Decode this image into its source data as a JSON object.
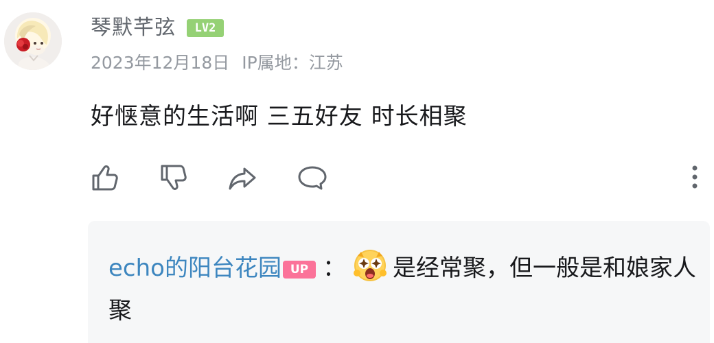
{
  "comment": {
    "username": "琴默芊弦",
    "level": "LV2",
    "date": "2023年12月18日",
    "ip_label": "IP属地：江苏",
    "text": "好惬意的生活啊  三五好友 时长相聚"
  },
  "actions": {
    "like_icon": "thumb-up-icon",
    "dislike_icon": "thumb-down-icon",
    "share_icon": "share-icon",
    "reply_icon": "comment-icon",
    "more_icon": "more-vertical-icon"
  },
  "reply_preview": {
    "author": "echo的阳台花园",
    "badge": "UP",
    "colon": "：",
    "emoji_icon": "surprised-emoji-icon",
    "text": "是经常聚，但一般是和娘家人聚"
  },
  "colors": {
    "username_gray": "#61666d",
    "meta_gray": "#9499a0",
    "level_green": "#95d175",
    "link_blue": "#3d86bf",
    "up_pink": "#fb7299",
    "reply_background": "#f6f7f8"
  }
}
